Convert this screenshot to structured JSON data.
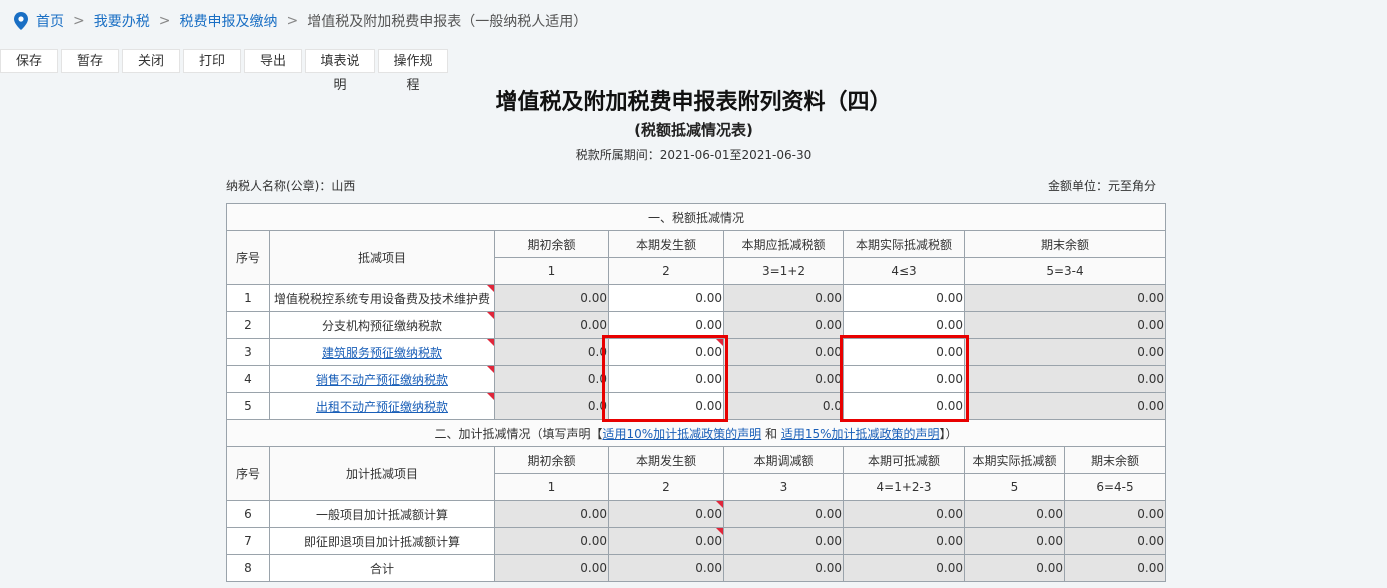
{
  "breadcrumb": {
    "home": "首页",
    "sep": ">",
    "level2": "我要办税",
    "level3": "税费申报及缴纳",
    "current": "增值税及附加税费申报表（一般纳税人适用）"
  },
  "toolbar": [
    "保存",
    "暂存",
    "关闭",
    "打印",
    "导出",
    "填表说明",
    "操作规程"
  ],
  "title": "增值税及附加税费申报表附列资料（四）",
  "subtitle": "(税额抵减情况表)",
  "period": "税款所属期间：2021-06-01至2021-06-30",
  "taxpayer": "纳税人名称(公章)：山西",
  "unit": "金额单位：元至角分",
  "section1": {
    "title": "一、税额抵减情况",
    "col_seq": "序号",
    "col_item": "抵减项目",
    "headers": [
      "期初余额",
      "本期发生额",
      "本期应抵减税额",
      "本期实际抵减税额",
      "期末余额"
    ],
    "codes": [
      "1",
      "2",
      "3=1+2",
      "4≤3",
      "5=3-4"
    ],
    "rows": [
      {
        "seq": "1",
        "item": "增值税税控系统专用设备费及技术维护费",
        "values": [
          "0.00",
          "0.00",
          "0.00",
          "0.00",
          "0.00"
        ]
      },
      {
        "seq": "2",
        "item": "分支机构预征缴纳税款",
        "values": [
          "0.00",
          "0.00",
          "0.00",
          "0.00",
          "0.00"
        ]
      },
      {
        "seq": "3",
        "item": "建筑服务预征缴纳税款",
        "values": [
          "0.0",
          "0.00",
          "0.00",
          "0.00",
          "0.00"
        ]
      },
      {
        "seq": "4",
        "item": "销售不动产预征缴纳税款",
        "values": [
          "0.0",
          "0.00",
          "0.00",
          "0.00",
          "0.00"
        ]
      },
      {
        "seq": "5",
        "item": "出租不动产预征缴纳税款",
        "values": [
          "0.0",
          "0.00",
          "0.0",
          "0.00",
          "0.00"
        ]
      }
    ]
  },
  "section2": {
    "title_prefix": "二、加计抵减情况（填写声明【",
    "link1": "适用10%加计抵减政策的声明",
    "and": "和",
    "link2": "适用15%加计抵减政策的声明",
    "title_suffix": "】）",
    "col_seq": "序号",
    "col_item": "加计抵减项目",
    "headers": [
      "期初余额",
      "本期发生额",
      "本期调减额",
      "本期可抵减额",
      "本期实际抵减额",
      "期末余额"
    ],
    "codes": [
      "1",
      "2",
      "3",
      "4=1+2-3",
      "5",
      "6=4-5"
    ],
    "rows": [
      {
        "seq": "6",
        "item": "一般项目加计抵减额计算",
        "values": [
          "0.00",
          "0.00",
          "0.00",
          "0.00",
          "0.00",
          "0.00"
        ]
      },
      {
        "seq": "7",
        "item": "即征即退项目加计抵减额计算",
        "values": [
          "0.00",
          "0.00",
          "0.00",
          "0.00",
          "0.00",
          "0.00"
        ]
      },
      {
        "seq": "8",
        "item": "合计",
        "values": [
          "0.00",
          "0.00",
          "0.00",
          "0.00",
          "0.00",
          "0.00"
        ]
      }
    ]
  },
  "colors": {
    "accent": "#1a6fc4",
    "highlight": "#e80000",
    "marker": "#e0263a",
    "readonly_cell": "#e4e4e4"
  }
}
